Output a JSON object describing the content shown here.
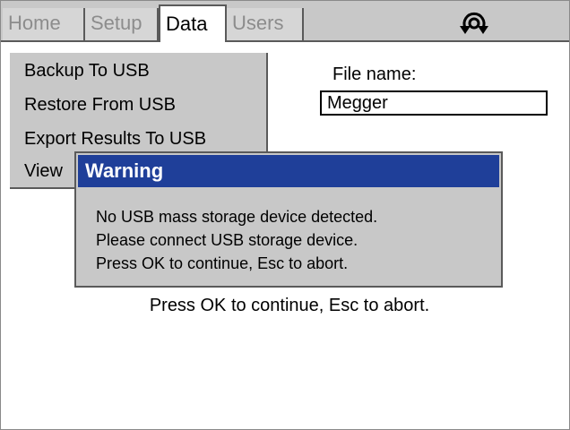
{
  "tabs": [
    {
      "label": "Home",
      "active": false
    },
    {
      "label": "Setup",
      "active": false
    },
    {
      "label": "Data",
      "active": true
    },
    {
      "label": "Users",
      "active": false
    }
  ],
  "header_icon": "rotate-icon",
  "menu": {
    "items": [
      {
        "label": "Backup To USB"
      },
      {
        "label": "Restore From USB"
      },
      {
        "label": "Export Results To USB"
      },
      {
        "label": "View"
      }
    ]
  },
  "file": {
    "label": "File name:",
    "value": "Megger"
  },
  "background_prompt": "Press OK to continue, Esc to abort.",
  "dialog": {
    "title": "Warning",
    "lines": [
      "No USB mass storage device detected.",
      "Please connect USB storage device.",
      "Press OK to continue, Esc to abort."
    ]
  },
  "colors": {
    "title_bar": "#1f3f99",
    "panel_gray": "#c8c8c8",
    "inactive_text": "#8c8c8c"
  }
}
